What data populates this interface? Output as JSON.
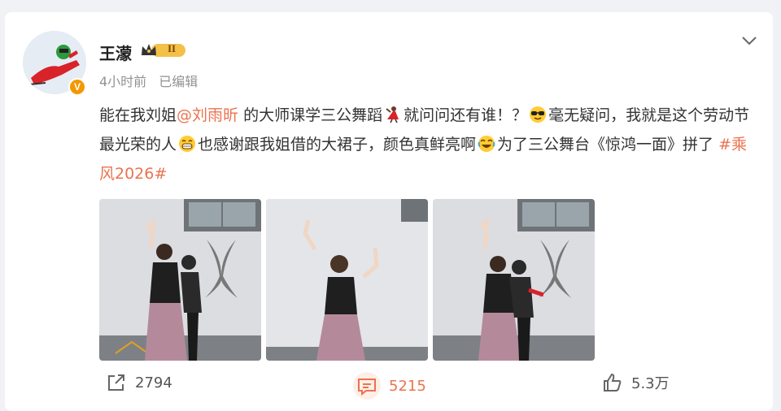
{
  "user": {
    "name": "王濛",
    "level": "II",
    "verified_mark": "V",
    "time": "4小时前",
    "edited": "已编辑"
  },
  "post": {
    "text_1": "能在我刘姐",
    "mention": "@刘雨昕",
    "text_2": " 的大师课学三公舞蹈",
    "text_3": "就问问还有谁！？",
    "text_4": "毫无疑问，我就是这个劳动节最光荣的人",
    "text_5": "也感谢跟我姐借的大裙子，颜色真鲜亮啊",
    "text_6": "为了三公舞台《惊鸿一面》拼了 ",
    "hashtag": "#乘风2026#"
  },
  "actions": {
    "repost_count": "2794",
    "comment_count": "5215",
    "like_count": "5.3万"
  },
  "colors": {
    "accent": "#eb7350",
    "verified": "#f39800",
    "muted": "#939393"
  },
  "icons": [
    "chevron-down-icon",
    "repost-icon",
    "comment-icon",
    "like-icon",
    "crown-icon"
  ]
}
